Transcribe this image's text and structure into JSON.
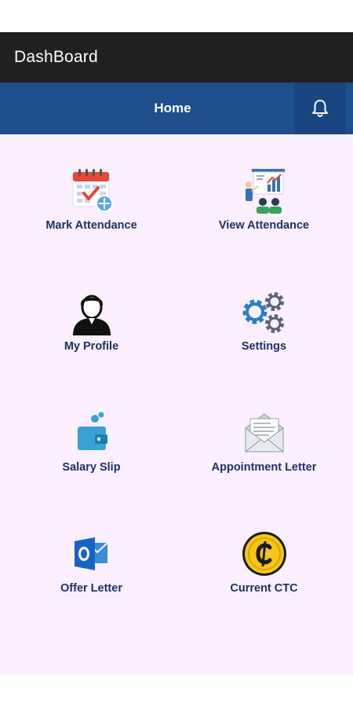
{
  "appbar": {
    "title": "DashBoard"
  },
  "navbar": {
    "home_label": "Home",
    "bell_icon": "bell-icon"
  },
  "tiles": [
    {
      "label": "Mark Attendance",
      "icon": "calendar-check-icon"
    },
    {
      "label": "View Attendance",
      "icon": "presentation-chart-icon"
    },
    {
      "label": "My Profile",
      "icon": "user-profile-icon"
    },
    {
      "label": "Settings",
      "icon": "gears-icon"
    },
    {
      "label": "Salary Slip",
      "icon": "wallet-icon"
    },
    {
      "label": "Appointment Letter",
      "icon": "envelope-letter-icon"
    },
    {
      "label": "Offer Letter",
      "icon": "outlook-icon"
    },
    {
      "label": "Current CTC",
      "icon": "coin-icon"
    }
  ],
  "colors": {
    "appbar_bg": "#202020",
    "navbar_bg": "#1f4e8c",
    "content_bg": "#fcefff",
    "label": "#1e2f6b"
  }
}
